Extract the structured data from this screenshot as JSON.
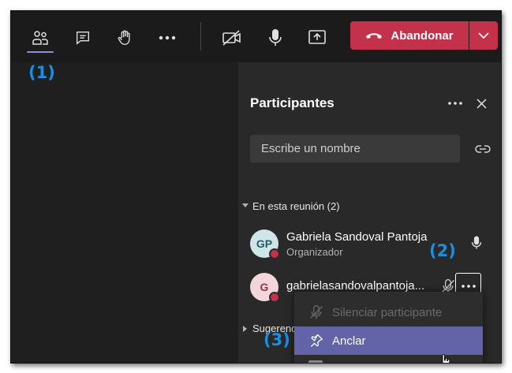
{
  "toolbar": {
    "leave_label": "Abandonar",
    "leave_color": "#c4314b",
    "icons": [
      "people-icon",
      "chat-icon",
      "raise-hand-icon",
      "more-icon",
      "camera-off-icon",
      "microphone-icon",
      "share-screen-icon",
      "phone-hangup-icon",
      "chevron-down-icon"
    ]
  },
  "callouts": {
    "one": "(1)",
    "two": "(2)",
    "three": "(3)",
    "color": "#1a8fe3"
  },
  "panel": {
    "title": "Participantes",
    "search_placeholder": "Escribe un nombre",
    "section_in_meeting": "En esta reunión (2)",
    "section_suggestions": "Sugerenc",
    "participants": [
      {
        "initials": "GP",
        "name": "Gabriela Sandoval Pantoja",
        "role": "Organizador"
      },
      {
        "initials": "G",
        "name": "gabrielasandovalpantoja...",
        "role": ""
      }
    ]
  },
  "menu": {
    "items": [
      {
        "label": "Silenciar participante",
        "state": "disabled"
      },
      {
        "label": "Anclar",
        "state": "hover"
      }
    ],
    "accent": "#6264a7"
  }
}
